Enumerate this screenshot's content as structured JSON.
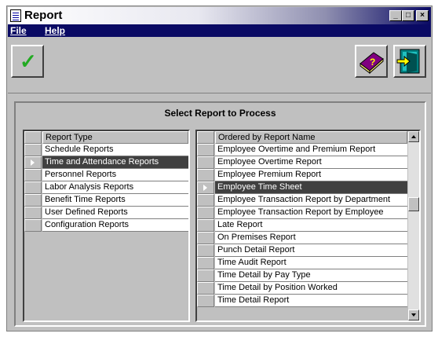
{
  "window": {
    "title": "Report"
  },
  "window_controls": {
    "minimize": "_",
    "maximize": "□",
    "close": "×"
  },
  "menu": [
    {
      "label": "File"
    },
    {
      "label": "Help"
    }
  ],
  "toolbar": {
    "ok_glyph": "✓",
    "help_glyph": "?"
  },
  "panel": {
    "title": "Select Report to Process"
  },
  "report_type": {
    "header": "Report Type",
    "selected_index": 1,
    "items": [
      "Schedule Reports",
      "Time and Attendance Reports",
      "Personnel Reports",
      "Labor Analysis Reports",
      "Benefit Time Reports",
      "User Defined Reports",
      "Configuration Reports"
    ]
  },
  "report_name": {
    "header": "Ordered by Report Name",
    "selected_index": 3,
    "items": [
      "Employee Overtime and Premium Report",
      "Employee Overtime Report",
      "Employee Premium Report",
      "Employee Time Sheet",
      "Employee Transaction Report by Department",
      "Employee Transaction Report by Employee",
      "Late Report",
      "On Premises Report",
      "Punch Detail Report",
      "Time Audit Report",
      "Time Detail by Pay Type",
      "Time Detail by Position Worked",
      "Time Detail Report"
    ]
  },
  "colors": {
    "title_active": "#0a0a64",
    "selection": "#404040",
    "check": "#22aa22",
    "book": "#800080"
  }
}
